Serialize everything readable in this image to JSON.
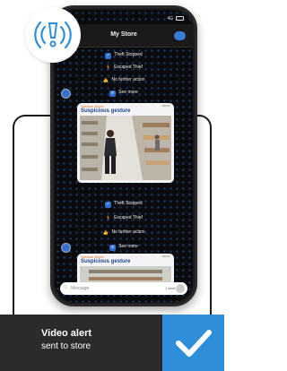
{
  "header": {
    "title": "My Store"
  },
  "status": {
    "network": "4G"
  },
  "actions": {
    "theft_stopped": "Theft Stopped",
    "escaped_thief": "Escaped Thief",
    "no_further_action": "No further action",
    "see_more": "See more"
  },
  "card": {
    "sender": "Veesion Alerts",
    "time": "admin",
    "title": "Suspicious gesture"
  },
  "input": {
    "placeholder": "Message",
    "sent_status": "1 sent"
  },
  "banner": {
    "title": "Video alert",
    "subtitle": "sent to store"
  },
  "colors": {
    "accent": "#2f8ed9",
    "banner_bg": "#2b2b2d",
    "title_blue": "#1d3f8a",
    "alert_orange": "#e07020"
  },
  "icons": [
    "alert-icon",
    "checkmark-icon",
    "theft-stopped-icon",
    "escaped-thief-icon",
    "thumbs-up-icon",
    "see-more-icon",
    "mic-icon",
    "emoji-icon"
  ]
}
